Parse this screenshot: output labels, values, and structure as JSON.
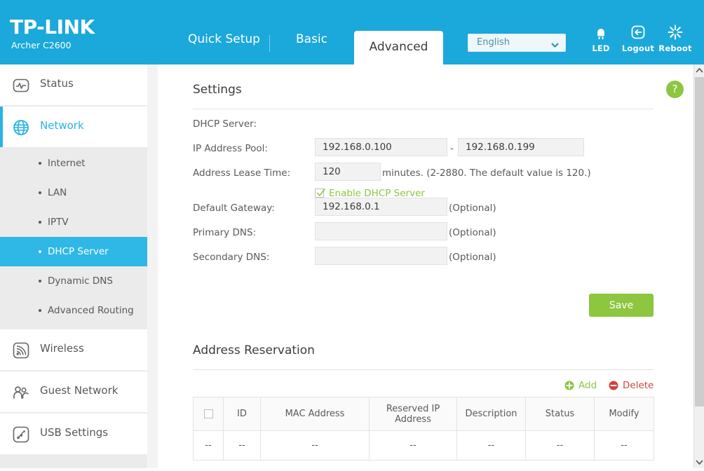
{
  "header": {
    "logo": "TP-LINK",
    "model": "Archer C2600",
    "nav": {
      "quick_setup": "Quick Setup",
      "basic": "Basic",
      "advanced": "Advanced"
    },
    "language": {
      "selected": "English",
      "options": [
        "English"
      ]
    },
    "icons": [
      {
        "name": "led-icon",
        "label": "LED"
      },
      {
        "name": "logout-icon",
        "label": "Logout"
      },
      {
        "name": "reboot-icon",
        "label": "Reboot"
      }
    ]
  },
  "sidebar": {
    "items": [
      {
        "label": "Status",
        "icon": "status-icon",
        "active": false
      },
      {
        "label": "Network",
        "icon": "globe-icon",
        "active": true
      },
      {
        "label": "Wireless",
        "icon": "wireless-icon",
        "active": false
      },
      {
        "label": "Guest Network",
        "icon": "guest-network-icon",
        "active": false
      },
      {
        "label": "USB Settings",
        "icon": "usb-settings-icon",
        "active": false
      }
    ],
    "submenu": [
      {
        "label": "Internet",
        "active": false
      },
      {
        "label": "LAN",
        "active": false
      },
      {
        "label": "IPTV",
        "active": false
      },
      {
        "label": "DHCP Server",
        "active": true
      },
      {
        "label": "Dynamic DNS",
        "active": false
      },
      {
        "label": "Advanced Routing",
        "active": false
      }
    ]
  },
  "content": {
    "help_label": "?",
    "settings": {
      "title": "Settings",
      "dhcp_server_label": "DHCP Server:",
      "enable_dhcp_label": "Enable DHCP Server",
      "enable_dhcp_checked": true,
      "ip_pool_label": "IP Address Pool:",
      "ip_pool_start": "192.168.0.100",
      "ip_pool_end": "192.168.0.199",
      "ip_pool_separator": "-",
      "lease_time_label": "Address Lease Time:",
      "lease_time_value": "120",
      "lease_time_hint": "minutes. (2-2880. The default value is 120.)",
      "gateway_label": "Default Gateway:",
      "gateway_value": "192.168.0.1",
      "gateway_optional": "(Optional)",
      "primary_dns_label": "Primary DNS:",
      "primary_dns_value": "",
      "primary_dns_optional": "(Optional)",
      "secondary_dns_label": "Secondary DNS:",
      "secondary_dns_value": "",
      "secondary_dns_optional": "(Optional)",
      "save_label": "Save"
    },
    "reservation": {
      "title": "Address Reservation",
      "add_label": "Add",
      "delete_label": "Delete",
      "columns": [
        "",
        "ID",
        "MAC Address",
        "Reserved IP Address",
        "Description",
        "Status",
        "Modify"
      ],
      "rows": [
        [
          "--",
          "--",
          "--",
          "--",
          "--",
          "--",
          "--"
        ]
      ]
    }
  },
  "colors": {
    "brand_blue": "#1ba8da",
    "accent_cyan": "#29b3e3",
    "green": "#8dc63f",
    "red": "#d0453d"
  }
}
